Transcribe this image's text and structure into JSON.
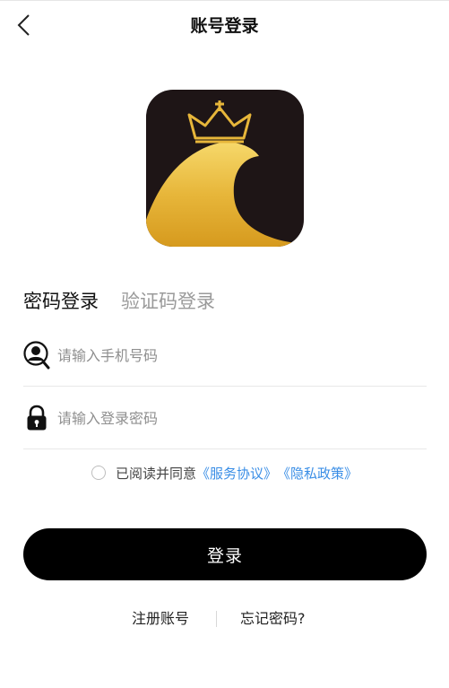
{
  "header": {
    "title": "账号登录",
    "back_icon": "chevron-left-icon"
  },
  "logo": {
    "icon": "crown-wave-logo",
    "colors": {
      "background": "#1e1516",
      "gold": "#e9b93a"
    }
  },
  "tabs": [
    {
      "label": "密码登录",
      "active": true
    },
    {
      "label": "验证码登录",
      "active": false
    }
  ],
  "form": {
    "phone": {
      "placeholder": "请输入手机号码",
      "value": "",
      "icon": "user-search-icon"
    },
    "password": {
      "placeholder": "请输入登录密码",
      "value": "",
      "icon": "lock-icon"
    }
  },
  "agreement": {
    "prefix": "已阅读并同意",
    "service_link": "《服务协议》",
    "privacy_link": "《隐私政策》",
    "checked": false
  },
  "actions": {
    "login_label": "登录",
    "register_label": "注册账号",
    "forgot_label": "忘记密码?"
  },
  "colors": {
    "primary_button": "#000000",
    "link": "#3a8ee6",
    "inactive_tab": "#9a9a9a",
    "placeholder": "#8f8f8f",
    "divider": "#e8e8e8"
  }
}
